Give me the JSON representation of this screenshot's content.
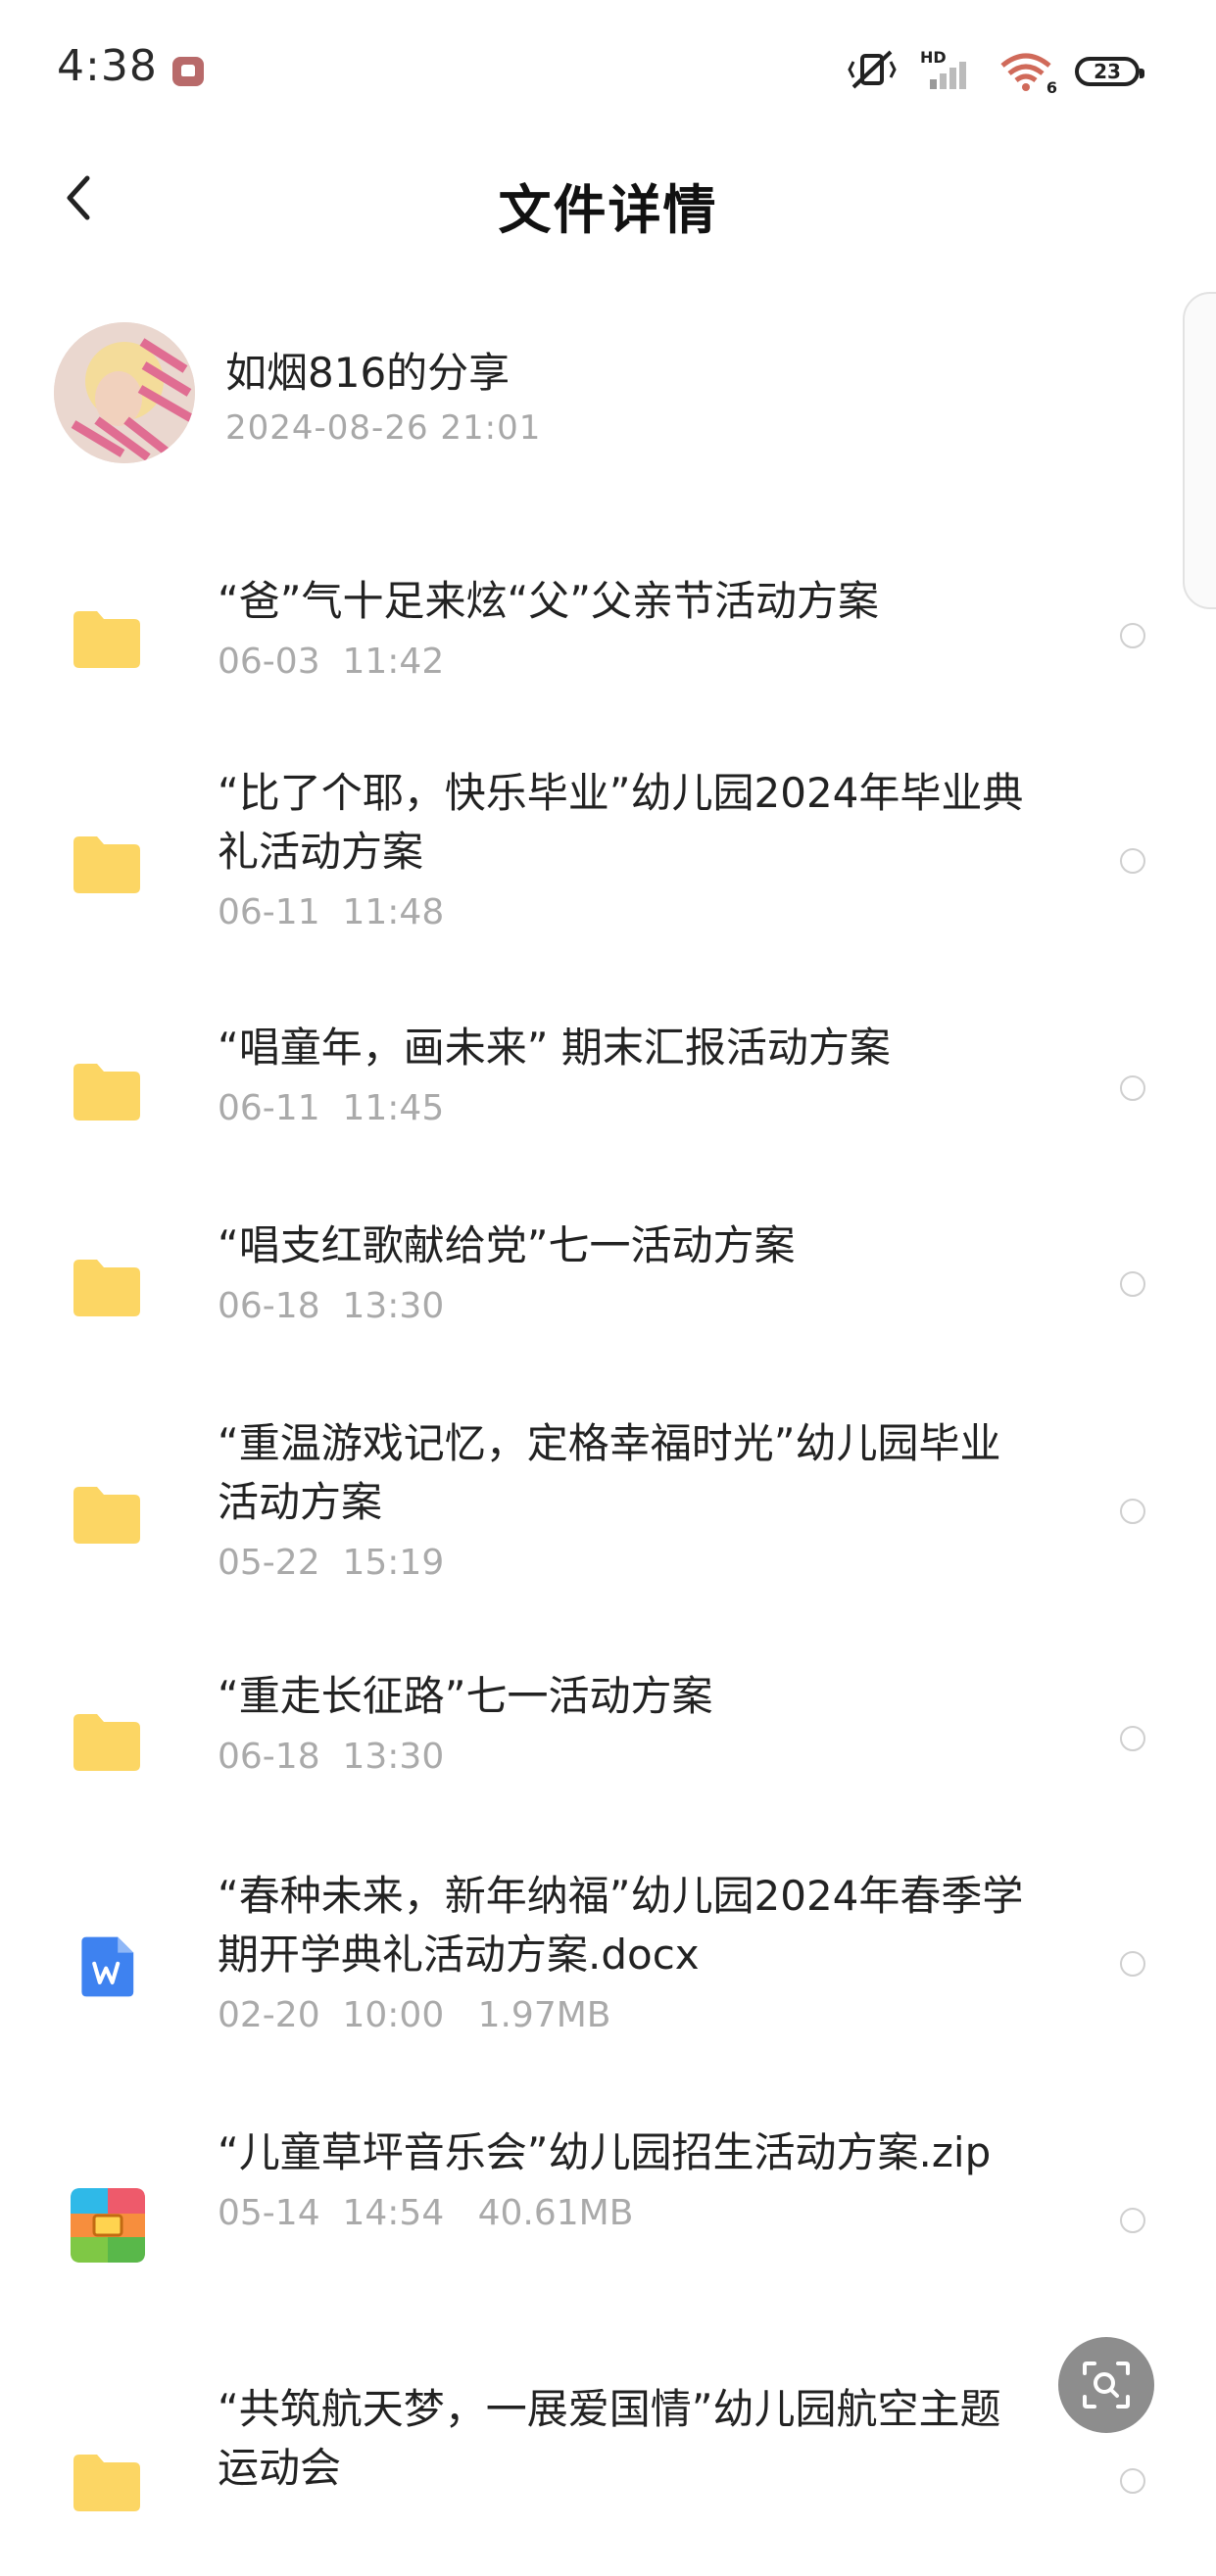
{
  "status_bar": {
    "time": "4:38",
    "hd_label": "HD",
    "wifi_label": "6",
    "battery": "23"
  },
  "header": {
    "title": "文件详情"
  },
  "sharer": {
    "name": "如烟816的分享",
    "time": "2024-08-26  21:01"
  },
  "files": [
    {
      "name": "“爸”气十足来炫“父”父亲节活动方案",
      "meta": "06-03  11:42",
      "type": "folder-icon"
    },
    {
      "name": "“比了个耶，快乐毕业”幼儿园2024年毕业典礼活动方案",
      "meta": "06-11  11:48",
      "type": "folder-icon"
    },
    {
      "name": "“唱童年，画未来” 期末汇报活动方案",
      "meta": "06-11  11:45",
      "type": "folder-icon"
    },
    {
      "name": "“唱支红歌献给党”七一活动方案",
      "meta": "06-18  13:30",
      "type": "folder-icon"
    },
    {
      "name": "“重温游戏记忆，定格幸福时光”幼儿园毕业活动方案",
      "meta": "05-22  15:19",
      "type": "folder-icon"
    },
    {
      "name": "“重走长征路”七一活动方案",
      "meta": "06-18  13:30",
      "type": "folder-icon"
    },
    {
      "name": "“春种未来，新年纳福”幼儿园2024年春季学期开学典礼活动方案.docx",
      "meta": "02-20  10:00   1.97MB",
      "type": "word-doc-icon"
    },
    {
      "name": "“儿童草坪音乐会”幼儿园招生活动方案.zip",
      "meta": "05-14  14:54   40.61MB",
      "type": "zip-archive-icon"
    },
    {
      "name": "“共筑航天梦，一展爱国情”幼儿园航空主题运动会",
      "meta": "",
      "type": "folder-icon"
    }
  ],
  "colors": {
    "folder": "#fcd664",
    "word": "#3e82f0",
    "meta_text": "#aaaaaa",
    "fab": "#8d8d8d"
  }
}
